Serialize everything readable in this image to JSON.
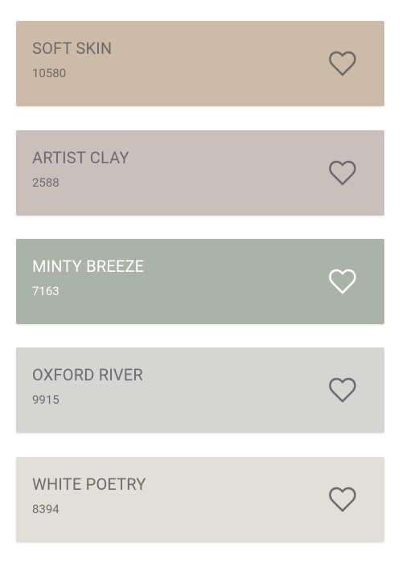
{
  "swatches": [
    {
      "name": "SOFT SKIN",
      "code": "10580",
      "color": "#cbbba8",
      "text_color": "#6f6a66"
    },
    {
      "name": "ARTIST CLAY",
      "code": "2588",
      "color": "#cbbfbd",
      "text_color": "#6f6a6a"
    },
    {
      "name": "MINTY BREEZE",
      "code": "7163",
      "color": "#abb2a8",
      "text_color": "#ffffff"
    },
    {
      "name": "OXFORD RIVER",
      "code": "9915",
      "color": "#d5d5d3",
      "text_color": "#6c6c6c"
    },
    {
      "name": "WHITE POETRY",
      "code": "8394",
      "color": "#e2dfd9",
      "text_color": "#6c6c6c"
    }
  ],
  "favorite_icon": "heart-outline-icon"
}
